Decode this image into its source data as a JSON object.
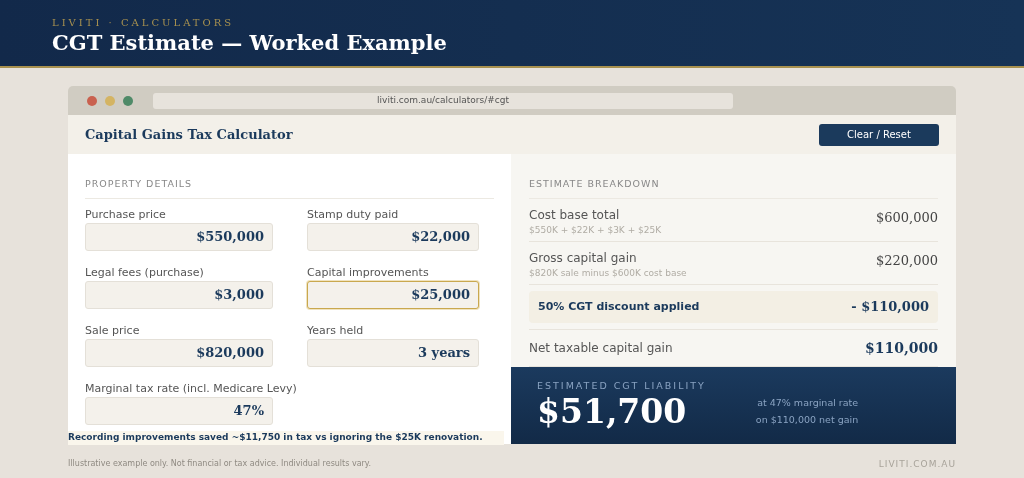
{
  "header": {
    "eyebrow": "LIVITI · CALCULATORS",
    "title": "CGT Estimate — Worked Example"
  },
  "browser": {
    "url": "liviti.com.au/calculators/#cgt"
  },
  "calculator": {
    "title": "Capital Gains Tax Calculator",
    "reset_button": "Clear / Reset"
  },
  "property_details": {
    "heading": "PROPERTY DETAILS",
    "fields": [
      {
        "label": "Purchase price",
        "value": "$550,000",
        "focused": false
      },
      {
        "label": "Stamp duty paid",
        "value": "$22,000",
        "focused": false
      },
      {
        "label": "Legal fees (purchase)",
        "value": "$3,000",
        "focused": false
      },
      {
        "label": "Capital improvements",
        "value": "$25,000",
        "focused": true
      },
      {
        "label": "Sale price",
        "value": "$820,000",
        "focused": false
      },
      {
        "label": "Years held",
        "value": "3 years",
        "focused": false
      },
      {
        "label": "Marginal tax rate (incl. Medicare Levy)",
        "value": "47%",
        "focused": false
      }
    ],
    "note": "Recording improvements saved ~$11,750 in tax vs ignoring the $25K renovation."
  },
  "breakdown": {
    "heading": "ESTIMATE BREAKDOWN",
    "rows": [
      {
        "kind": "plain",
        "label": "Cost base total",
        "detail": "$550K + $22K + $3K + $25K",
        "value": "$600,000"
      },
      {
        "kind": "plain",
        "label": "Gross capital gain",
        "detail": "$820K sale minus $600K cost base",
        "value": "$220,000"
      },
      {
        "kind": "highlight",
        "label": "50% CGT discount applied",
        "value": "- $110,000"
      },
      {
        "kind": "total",
        "label": "Net taxable capital gain",
        "value": "$110,000"
      }
    ]
  },
  "liability": {
    "label": "ESTIMATED CGT LIABILITY",
    "amount": "$51,700",
    "notes": [
      "at 47% marginal rate",
      "on $110,000 net gain"
    ]
  },
  "footer": {
    "disclaimer": "Illustrative example only. Not financial or tax advice. Individual results vary.",
    "site": "LIVITI.COM.AU"
  }
}
